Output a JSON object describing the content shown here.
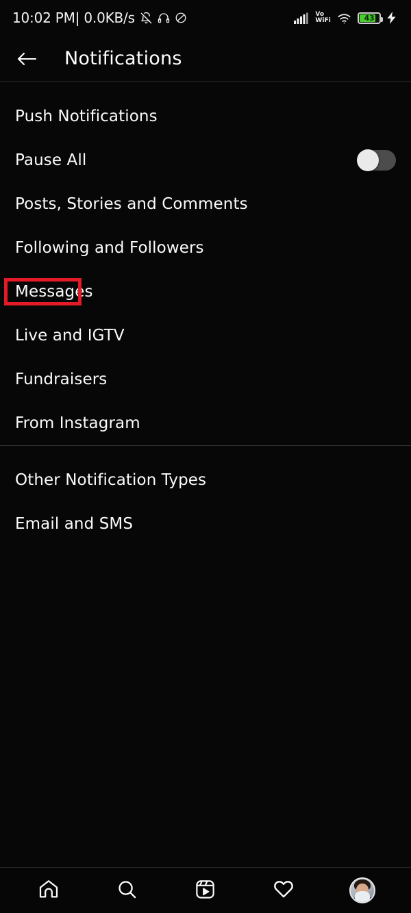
{
  "statusbar": {
    "time_text": "10:02 PM| 0.0KB/s",
    "icons_left": [
      "bell-muted-icon",
      "headphones-icon",
      "dnd-icon"
    ],
    "signal_icon": "signal-bars-icon",
    "vowifi_line1": "Vo",
    "vowifi_line2": "WiFi",
    "wifi_icon": "wifi-icon",
    "battery_level": "43",
    "battery_color": "#45d12a",
    "charging_icon": "lightning-bolt-icon"
  },
  "header": {
    "back_icon": "back-arrow-icon",
    "title": "Notifications"
  },
  "annotation": {
    "color": "#e31b28",
    "target": "Messages"
  },
  "sections": [
    {
      "id": "push-notifications",
      "items": [
        {
          "label": "Push Notifications",
          "type": "section-header",
          "name": "section-header-push-notifications"
        },
        {
          "label": "Pause All",
          "type": "toggle",
          "name": "row-pause-all",
          "toggle_state": "off"
        },
        {
          "label": "Posts, Stories and Comments",
          "type": "link",
          "name": "row-posts-stories-comments"
        },
        {
          "label": "Following and Followers",
          "type": "link",
          "name": "row-following-and-followers"
        },
        {
          "label": "Messages",
          "type": "link",
          "name": "row-messages",
          "highlighted": true
        },
        {
          "label": "Live and IGTV",
          "type": "link",
          "name": "row-live-and-igtv"
        },
        {
          "label": "Fundraisers",
          "type": "link",
          "name": "row-fundraisers"
        },
        {
          "label": "From Instagram",
          "type": "link",
          "name": "row-from-instagram"
        }
      ]
    },
    {
      "id": "other-notification-types",
      "items": [
        {
          "label": "Other Notification Types",
          "type": "section-header",
          "name": "section-header-other-notification-types"
        },
        {
          "label": "Email and SMS",
          "type": "link",
          "name": "row-email-and-sms"
        }
      ]
    }
  ],
  "bottomnav": {
    "items": [
      {
        "name": "nav-home",
        "icon": "home-icon"
      },
      {
        "name": "nav-search",
        "icon": "search-icon"
      },
      {
        "name": "nav-reels",
        "icon": "reels-icon"
      },
      {
        "name": "nav-activity",
        "icon": "heart-icon"
      },
      {
        "name": "nav-profile",
        "icon": "avatar-icon"
      }
    ]
  }
}
